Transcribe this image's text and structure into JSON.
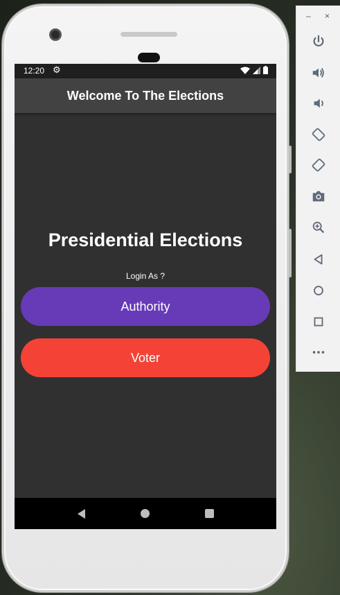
{
  "status_bar": {
    "time": "12:20"
  },
  "app_bar": {
    "title": "Welcome To The Elections"
  },
  "main": {
    "heading": "Presidential Elections",
    "prompt": "Login As ?",
    "authority_label": "Authority",
    "voter_label": "Voter"
  },
  "emulator_toolbar": {
    "minimize": "–",
    "close": "×"
  },
  "colors": {
    "authority_button": "#673ab7",
    "voter_button": "#f44336",
    "app_bar": "#424242",
    "screen_background": "#303030",
    "toolbar_icon": "#5f6b7a"
  },
  "icons": [
    "settings-icon",
    "wifi-icon",
    "signal-icon",
    "battery-icon",
    "power-icon",
    "volume-up-icon",
    "volume-down-icon",
    "rotate-left-icon",
    "rotate-right-icon",
    "camera-icon",
    "zoom-icon",
    "back-icon",
    "home-icon",
    "overview-icon",
    "more-icon"
  ]
}
